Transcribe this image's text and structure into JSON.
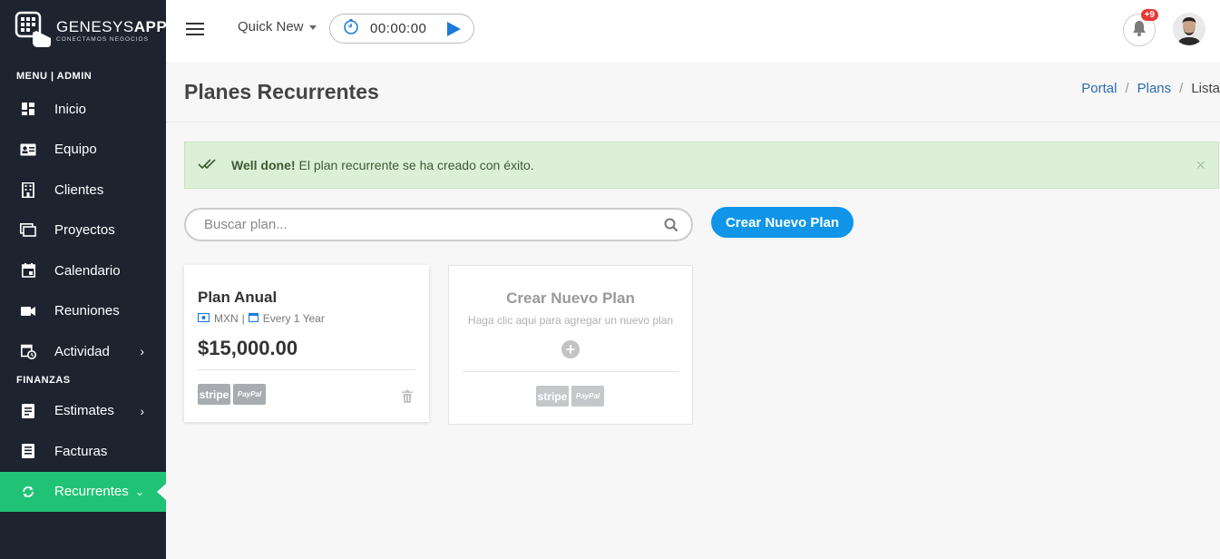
{
  "app": {
    "logo_title_light": "GENESYS",
    "logo_title_bold": "APP",
    "logo_subtitle": "CONECTAMOS NEGOCIOS"
  },
  "sidebar": {
    "section_menu": "MENU | ADMIN",
    "section_finanzas": "FINANZAS",
    "items": [
      {
        "label": "Inicio",
        "icon": "dashboard-icon"
      },
      {
        "label": "Equipo",
        "icon": "id-card-icon"
      },
      {
        "label": "Clientes",
        "icon": "building-icon"
      },
      {
        "label": "Proyectos",
        "icon": "folder-icon"
      },
      {
        "label": "Calendario",
        "icon": "calendar-icon"
      },
      {
        "label": "Reuniones",
        "icon": "video-icon"
      },
      {
        "label": "Actividad",
        "icon": "activity-icon"
      },
      {
        "label": "Estimates",
        "icon": "document-icon"
      },
      {
        "label": "Facturas",
        "icon": "invoice-icon"
      },
      {
        "label": "Recurrentes",
        "icon": "refresh-icon"
      }
    ],
    "active_color": "#20c375"
  },
  "topbar": {
    "quick_new": "Quick New",
    "timer": "00:00:00",
    "notifications_badge": "+9"
  },
  "page": {
    "title": "Planes Recurrentes",
    "breadcrumb": [
      "Portal",
      "Plans",
      "Lista"
    ]
  },
  "alert": {
    "strong": "Well done!",
    "message": "El plan recurrente se ha creado con éxito.",
    "close": "×"
  },
  "search": {
    "placeholder": "Buscar plan..."
  },
  "actions": {
    "create_plan": "Crear Nuevo Plan"
  },
  "plans": [
    {
      "name": "Plan Anual",
      "currency": "MXN",
      "interval": "Every 1 Year",
      "price": "$15,000.00",
      "gateways": [
        "stripe",
        "PayPal"
      ]
    }
  ],
  "add_card": {
    "title": "Crear Nuevo Plan",
    "subtitle": "Haga clic aqui para agregar un nuevo plan",
    "gateways": [
      "stripe",
      "PayPal"
    ]
  },
  "colors": {
    "sidebar_bg": "#1e2330",
    "primary_button": "#1095e8",
    "alert_bg": "#ddf0d7",
    "badge": "#e53935"
  }
}
